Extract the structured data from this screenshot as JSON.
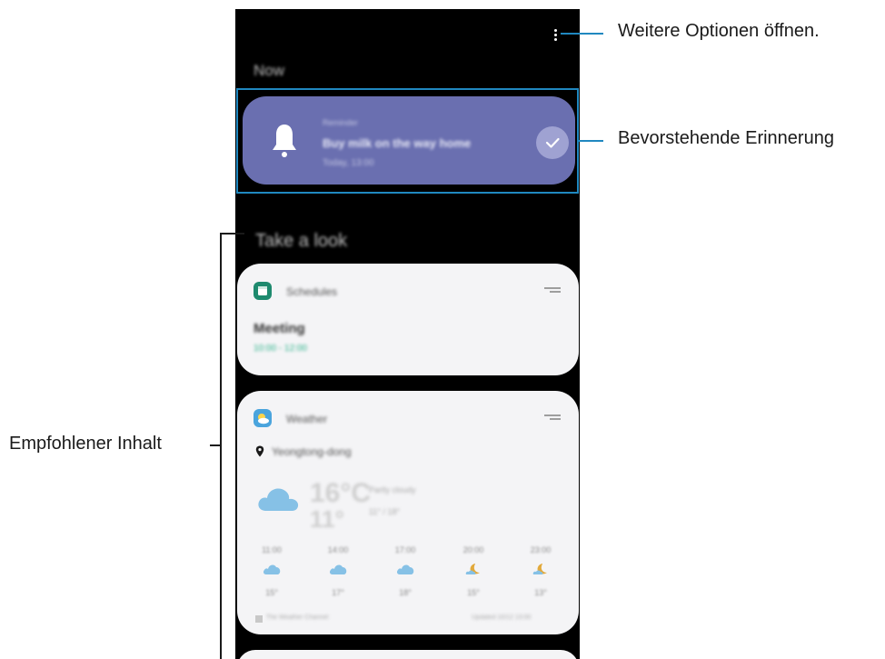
{
  "screen": {
    "now_label": "Now",
    "look_label": "Take a look",
    "more_options": "more-options"
  },
  "reminder": {
    "label": "Reminder",
    "title": "Buy milk on the way home",
    "time": "Today, 13:00"
  },
  "schedule_card": {
    "app_name": "Schedules",
    "event": "Meeting",
    "time": "10:00 - 12:00"
  },
  "weather_card": {
    "app_name": "Weather",
    "location": "Yeongtong-dong",
    "temperature": "16°C",
    "condition": "Partly cloudy",
    "low": "11°",
    "range": "11° / 18°",
    "source": "The Weather Channel",
    "updated": "Updated 10/12 13:00",
    "hours": [
      {
        "time": "11:00",
        "icon": "cloud-icon",
        "temp": "15°"
      },
      {
        "time": "14:00",
        "icon": "cloud-icon",
        "temp": "17°"
      },
      {
        "time": "17:00",
        "icon": "cloud-icon",
        "temp": "18°"
      },
      {
        "time": "20:00",
        "icon": "moon-icon",
        "temp": "15°"
      },
      {
        "time": "23:00",
        "icon": "moon-icon",
        "temp": "13°"
      }
    ]
  },
  "callouts": {
    "more": "Weitere Optionen öffnen.",
    "reminder": "Bevorstehende Erinnerung",
    "recommended": "Empfohlener Inhalt"
  },
  "colors": {
    "reminder_card": "#6a6fb0",
    "highlight": "#2088c0",
    "schedule_icon": "#1e8a6e",
    "weather_icon": "#4aa4dd",
    "cloud": "#86c1e6",
    "moon": "#e2a93b"
  }
}
